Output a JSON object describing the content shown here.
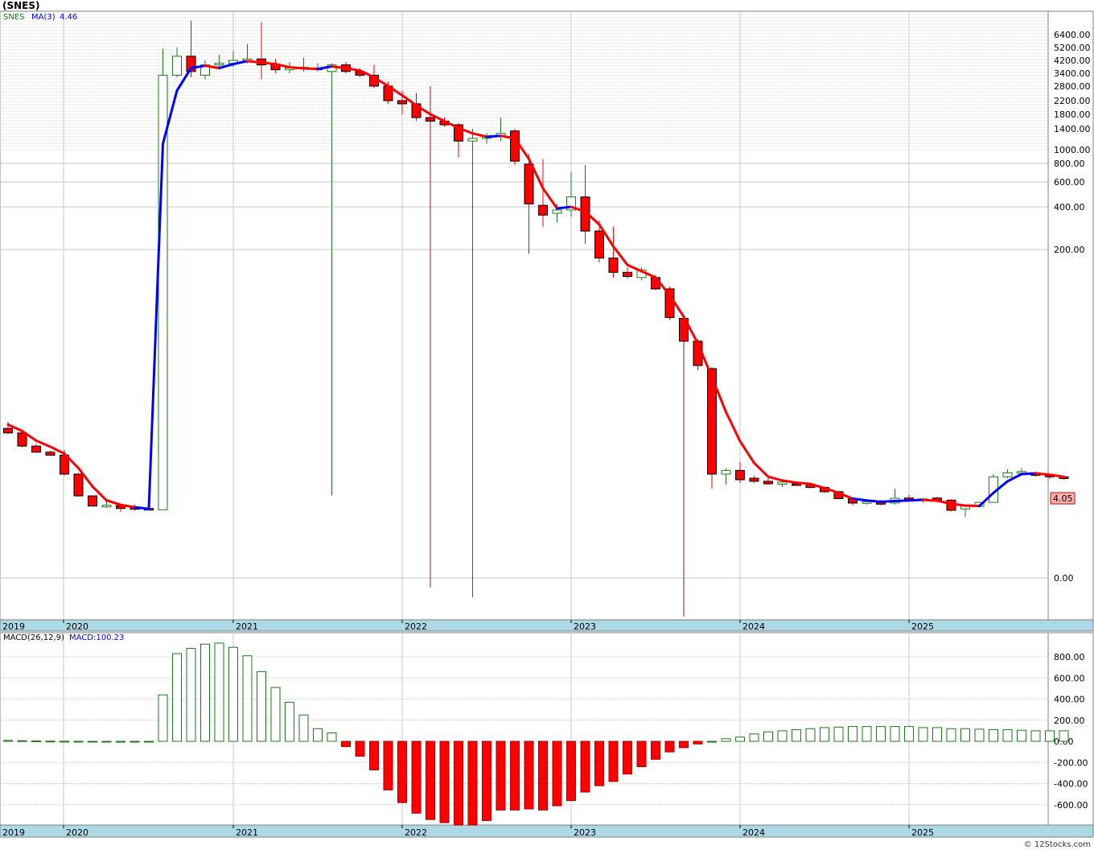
{
  "title": "(SNES)",
  "credit": "© 12Stocks.com",
  "colors": {
    "up": "#1a7a1a",
    "down": "#ff0000",
    "ma_up": "#0000ff",
    "ma_down": "#ff0000",
    "axis_bar": "#add8e6",
    "price_tag": "#ffb3b3"
  },
  "price_panel": {
    "legend_symbol": "SNES",
    "legend_ma": "MA(3)",
    "legend_ma_value": "4.46",
    "last_price_label": "4.05",
    "tick_labels": [
      "6400.00",
      "5200.00",
      "4200.00",
      "3400.00",
      "2800.00",
      "2200.00",
      "1800.00",
      "1400.00",
      "1000.00",
      "800.00",
      "600.00",
      "400.00",
      "200.00",
      "0.00"
    ]
  },
  "macd_panel": {
    "legend_name": "MACD(26,12,9)",
    "legend_value": "MACD:100.23",
    "tick_labels": [
      "800.00",
      "600.00",
      "400.00",
      "200.00",
      "0.00",
      "-200.00",
      "-400.00",
      "-600.00"
    ]
  },
  "x_axis": {
    "labels": [
      "2019",
      "2020",
      "2021",
      "2022",
      "2023",
      "2024",
      "2025"
    ]
  },
  "chart_data": {
    "type": "candlestick",
    "interval": "monthly",
    "yscale": "log",
    "series_note": "OHLC, one candle per month, Dec 2019 – Sep 2025",
    "candles": [
      {
        "d": "2019-12",
        "o": 8.6,
        "h": 10.2,
        "l": 7.4,
        "c": 7.6
      },
      {
        "d": "2020-01",
        "o": 7.6,
        "h": 7.8,
        "l": 5.0,
        "c": 5.2
      },
      {
        "d": "2020-02",
        "o": 5.2,
        "h": 5.6,
        "l": 4.2,
        "c": 4.3
      },
      {
        "d": "2020-03",
        "o": 4.3,
        "h": 4.5,
        "l": 3.8,
        "c": 3.9
      },
      {
        "d": "2020-04",
        "o": 3.9,
        "h": 4.6,
        "l": 1.9,
        "c": 2.0
      },
      {
        "d": "2020-05",
        "o": 2.0,
        "h": 2.1,
        "l": 0.75,
        "c": 0.78
      },
      {
        "d": "2020-06",
        "o": 0.78,
        "h": 0.79,
        "l": 0.44,
        "c": 0.46
      },
      {
        "d": "2020-07",
        "o": 0.44,
        "h": 0.6,
        "l": 0.41,
        "c": 0.48
      },
      {
        "d": "2020-08",
        "o": 0.47,
        "h": 0.52,
        "l": 0.33,
        "c": 0.4
      },
      {
        "d": "2020-09",
        "o": 0.42,
        "h": 0.5,
        "l": 0.36,
        "c": 0.39
      },
      {
        "d": "2020-10",
        "o": 0.4,
        "h": 0.62,
        "l": 0.38,
        "c": 0.37
      },
      {
        "d": "2020-11",
        "o": 0.37,
        "h": 5100,
        "l": 0.37,
        "c": 3300
      },
      {
        "d": "2020-12",
        "o": 3300,
        "h": 5200,
        "l": 3200,
        "c": 4500
      },
      {
        "d": "2021-01",
        "o": 4500,
        "h": 8000,
        "l": 3200,
        "c": 3500
      },
      {
        "d": "2021-02",
        "o": 3300,
        "h": 4200,
        "l": 3100,
        "c": 3900
      },
      {
        "d": "2021-03",
        "o": 3900,
        "h": 4600,
        "l": 3700,
        "c": 4000
      },
      {
        "d": "2021-04",
        "o": 4000,
        "h": 4900,
        "l": 3800,
        "c": 4200
      },
      {
        "d": "2021-05",
        "o": 4200,
        "h": 5500,
        "l": 4000,
        "c": 4300
      },
      {
        "d": "2021-06",
        "o": 4300,
        "h": 7800,
        "l": 3100,
        "c": 3900
      },
      {
        "d": "2021-07",
        "o": 3900,
        "h": 4300,
        "l": 3400,
        "c": 3600
      },
      {
        "d": "2021-08",
        "o": 3600,
        "h": 4100,
        "l": 3400,
        "c": 3700
      },
      {
        "d": "2021-09",
        "o": 3700,
        "h": 4400,
        "l": 3500,
        "c": 3750
      },
      {
        "d": "2021-10",
        "o": 3700,
        "h": 4000,
        "l": 3500,
        "c": 3650
      },
      {
        "d": "2021-11",
        "o": 3500,
        "h": 4000,
        "l": 0.8,
        "c": 3900
      },
      {
        "d": "2021-12",
        "o": 3900,
        "h": 4100,
        "l": 3400,
        "c": 3500
      },
      {
        "d": "2022-01",
        "o": 3500,
        "h": 3700,
        "l": 3200,
        "c": 3300
      },
      {
        "d": "2022-02",
        "o": 3300,
        "h": 3900,
        "l": 2700,
        "c": 2800
      },
      {
        "d": "2022-03",
        "o": 2800,
        "h": 3000,
        "l": 2100,
        "c": 2200
      },
      {
        "d": "2022-04",
        "o": 2200,
        "h": 2600,
        "l": 1800,
        "c": 2100
      },
      {
        "d": "2022-05",
        "o": 2100,
        "h": 2500,
        "l": 1600,
        "c": 1700
      },
      {
        "d": "2022-06",
        "o": 1700,
        "h": 2800,
        "l": -0.3,
        "c": 1600
      },
      {
        "d": "2022-07",
        "o": 1600,
        "h": 1700,
        "l": 1450,
        "c": 1500
      },
      {
        "d": "2022-08",
        "o": 1500,
        "h": 1550,
        "l": 880,
        "c": 1150
      },
      {
        "d": "2022-09",
        "o": 1150,
        "h": 1400,
        "l": -0.6,
        "c": 1200
      },
      {
        "d": "2022-10",
        "o": 1200,
        "h": 1300,
        "l": 1100,
        "c": 1250
      },
      {
        "d": "2022-11",
        "o": 1250,
        "h": 1700,
        "l": 1150,
        "c": 1300
      },
      {
        "d": "2022-12",
        "o": 1350,
        "h": 1400,
        "l": 780,
        "c": 830
      },
      {
        "d": "2023-01",
        "o": 790,
        "h": 940,
        "l": 190,
        "c": 420
      },
      {
        "d": "2023-02",
        "o": 410,
        "h": 860,
        "l": 290,
        "c": 350
      },
      {
        "d": "2023-03",
        "o": 360,
        "h": 420,
        "l": 310,
        "c": 380
      },
      {
        "d": "2023-04",
        "o": 380,
        "h": 700,
        "l": 340,
        "c": 470
      },
      {
        "d": "2023-05",
        "o": 470,
        "h": 780,
        "l": 220,
        "c": 270
      },
      {
        "d": "2023-06",
        "o": 270,
        "h": 320,
        "l": 170,
        "c": 180
      },
      {
        "d": "2023-07",
        "o": 180,
        "h": 290,
        "l": 140,
        "c": 150
      },
      {
        "d": "2023-08",
        "o": 150,
        "h": 160,
        "l": 138,
        "c": 142
      },
      {
        "d": "2023-09",
        "o": 140,
        "h": 160,
        "l": 135,
        "c": 155
      },
      {
        "d": "2023-10",
        "o": 140,
        "h": 145,
        "l": 118,
        "c": 120
      },
      {
        "d": "2023-11",
        "o": 120,
        "h": 124,
        "l": 76,
        "c": 79
      },
      {
        "d": "2023-12",
        "o": 78,
        "h": 80,
        "l": -1.2,
        "c": 54
      },
      {
        "d": "2024-01",
        "o": 54,
        "h": 56,
        "l": 32,
        "c": 35
      },
      {
        "d": "2024-02",
        "o": 33,
        "h": 34,
        "l": 1.1,
        "c": 2.0
      },
      {
        "d": "2024-03",
        "o": 2.0,
        "h": 2.5,
        "l": 1.3,
        "c": 2.3
      },
      {
        "d": "2024-04",
        "o": 2.3,
        "h": 3.1,
        "l": 1.4,
        "c": 1.6
      },
      {
        "d": "2024-05",
        "o": 1.7,
        "h": 1.9,
        "l": 1.4,
        "c": 1.5
      },
      {
        "d": "2024-06",
        "o": 1.5,
        "h": 1.7,
        "l": 1.3,
        "c": 1.35
      },
      {
        "d": "2024-07",
        "o": 1.33,
        "h": 1.55,
        "l": 1.18,
        "c": 1.45
      },
      {
        "d": "2024-08",
        "o": 1.35,
        "h": 1.45,
        "l": 1.28,
        "c": 1.33
      },
      {
        "d": "2024-09",
        "o": 1.32,
        "h": 1.38,
        "l": 1.12,
        "c": 1.15
      },
      {
        "d": "2024-10",
        "o": 1.15,
        "h": 1.2,
        "l": 0.9,
        "c": 0.95
      },
      {
        "d": "2024-11",
        "o": 0.95,
        "h": 0.99,
        "l": 0.66,
        "c": 0.68
      },
      {
        "d": "2024-12",
        "o": 0.67,
        "h": 0.69,
        "l": 0.48,
        "c": 0.54
      },
      {
        "d": "2025-01",
        "o": 0.55,
        "h": 0.62,
        "l": 0.5,
        "c": 0.58
      },
      {
        "d": "2025-02",
        "o": 0.56,
        "h": 0.64,
        "l": 0.48,
        "c": 0.51
      },
      {
        "d": "2025-03",
        "o": 0.54,
        "h": 1.08,
        "l": 0.5,
        "c": 0.69
      },
      {
        "d": "2025-04",
        "o": 0.7,
        "h": 0.82,
        "l": 0.62,
        "c": 0.63
      },
      {
        "d": "2025-05",
        "o": 0.63,
        "h": 0.7,
        "l": 0.55,
        "c": 0.67
      },
      {
        "d": "2025-06",
        "o": 0.7,
        "h": 0.74,
        "l": 0.57,
        "c": 0.6
      },
      {
        "d": "2025-07",
        "o": 0.63,
        "h": 0.66,
        "l": 0.34,
        "c": 0.36
      },
      {
        "d": "2025-08",
        "o": 0.39,
        "h": 0.46,
        "l": 0.24,
        "c": 0.46
      },
      {
        "d": "2025-09",
        "o": 0.45,
        "h": 0.57,
        "l": 0.44,
        "c": 0.56
      },
      {
        "d": "2025-10",
        "o": 0.56,
        "h": 2.0,
        "l": 0.56,
        "c": 1.8
      },
      {
        "d": "2025-11",
        "o": 1.8,
        "h": 2.4,
        "l": 1.7,
        "c": 2.1
      },
      {
        "d": "2025-12",
        "o": 2.1,
        "h": 2.5,
        "l": 1.9,
        "c": 2.2
      },
      {
        "d": "2026-01",
        "o": 2.1,
        "h": 2.2,
        "l": 1.8,
        "c": 1.9
      },
      {
        "d": "2026-02",
        "o": 1.95,
        "h": 2.0,
        "l": 1.65,
        "c": 1.8
      },
      {
        "d": "2026-03",
        "o": 1.8,
        "h": 1.82,
        "l": 1.6,
        "c": 1.68
      }
    ],
    "ma": [
      {
        "v": 9.5,
        "up": false
      },
      {
        "v": 8.0,
        "up": false
      },
      {
        "v": 6.1,
        "up": false
      },
      {
        "v": 5.1,
        "up": false
      },
      {
        "v": 4.1,
        "up": false
      },
      {
        "v": 2.5,
        "up": false
      },
      {
        "v": 1.2,
        "up": false
      },
      {
        "v": 0.62,
        "up": false
      },
      {
        "v": 0.49,
        "up": false
      },
      {
        "v": 0.43,
        "up": false
      },
      {
        "v": 0.39,
        "up": true
      },
      {
        "v": 1100,
        "up": true
      },
      {
        "v": 2600,
        "up": true
      },
      {
        "v": 3700,
        "up": true
      },
      {
        "v": 3850,
        "up": true
      },
      {
        "v": 3700,
        "up": false
      },
      {
        "v": 3950,
        "up": true
      },
      {
        "v": 4150,
        "up": true
      },
      {
        "v": 4050,
        "up": false
      },
      {
        "v": 3950,
        "up": false
      },
      {
        "v": 3750,
        "up": false
      },
      {
        "v": 3680,
        "up": false
      },
      {
        "v": 3650,
        "up": false
      },
      {
        "v": 3800,
        "up": true
      },
      {
        "v": 3700,
        "up": false
      },
      {
        "v": 3550,
        "up": false
      },
      {
        "v": 3200,
        "up": false
      },
      {
        "v": 2800,
        "up": false
      },
      {
        "v": 2400,
        "up": false
      },
      {
        "v": 2050,
        "up": false
      },
      {
        "v": 1800,
        "up": false
      },
      {
        "v": 1600,
        "up": false
      },
      {
        "v": 1420,
        "up": false
      },
      {
        "v": 1300,
        "up": false
      },
      {
        "v": 1230,
        "up": false
      },
      {
        "v": 1250,
        "up": true
      },
      {
        "v": 1200,
        "up": false
      },
      {
        "v": 860,
        "up": false
      },
      {
        "v": 540,
        "up": false
      },
      {
        "v": 390,
        "up": false
      },
      {
        "v": 400,
        "up": true
      },
      {
        "v": 370,
        "up": false
      },
      {
        "v": 300,
        "up": false
      },
      {
        "v": 210,
        "up": false
      },
      {
        "v": 165,
        "up": false
      },
      {
        "v": 152,
        "up": false
      },
      {
        "v": 140,
        "up": false
      },
      {
        "v": 110,
        "up": false
      },
      {
        "v": 80,
        "up": false
      },
      {
        "v": 52,
        "up": false
      },
      {
        "v": 28,
        "up": false
      },
      {
        "v": 13,
        "up": false
      },
      {
        "v": 6,
        "up": false
      },
      {
        "v": 3.0,
        "up": false
      },
      {
        "v": 1.8,
        "up": false
      },
      {
        "v": 1.55,
        "up": false
      },
      {
        "v": 1.42,
        "up": false
      },
      {
        "v": 1.34,
        "up": false
      },
      {
        "v": 1.12,
        "up": false
      },
      {
        "v": 0.9,
        "up": false
      },
      {
        "v": 0.68,
        "up": false
      },
      {
        "v": 0.62,
        "up": true
      },
      {
        "v": 0.58,
        "up": true
      },
      {
        "v": 0.6,
        "up": true
      },
      {
        "v": 0.62,
        "up": true
      },
      {
        "v": 0.64,
        "up": true
      },
      {
        "v": 0.61,
        "up": false
      },
      {
        "v": 0.52,
        "up": false
      },
      {
        "v": 0.47,
        "up": false
      },
      {
        "v": 0.46,
        "up": false
      },
      {
        "v": 0.9,
        "up": true
      },
      {
        "v": 1.5,
        "up": true
      },
      {
        "v": 2.0,
        "up": true
      },
      {
        "v": 2.05,
        "up": true
      },
      {
        "v": 1.95,
        "up": false
      },
      {
        "v": 1.8,
        "up": false
      }
    ],
    "macd_histogram": [
      8,
      6,
      4,
      2,
      1,
      0.5,
      0.2,
      0.1,
      0.1,
      0.1,
      0.1,
      440,
      830,
      880,
      920,
      930,
      890,
      810,
      660,
      510,
      370,
      250,
      120,
      80,
      -50,
      -140,
      -270,
      -460,
      -580,
      -680,
      -740,
      -770,
      -800,
      -800,
      -750,
      -650,
      -650,
      -640,
      -650,
      -610,
      -560,
      -480,
      -420,
      -380,
      -310,
      -240,
      -170,
      -100,
      -60,
      -25,
      0,
      25,
      40,
      70,
      90,
      100,
      110,
      120,
      130,
      135,
      140,
      140,
      140,
      140,
      140,
      130,
      130,
      120,
      120,
      115,
      110,
      110,
      105,
      100,
      100,
      100
    ],
    "macd_ylim": [
      -800,
      930
    ],
    "xlabels": [
      "2019",
      "2020",
      "2021",
      "2022",
      "2023",
      "2024",
      "2025"
    ]
  }
}
